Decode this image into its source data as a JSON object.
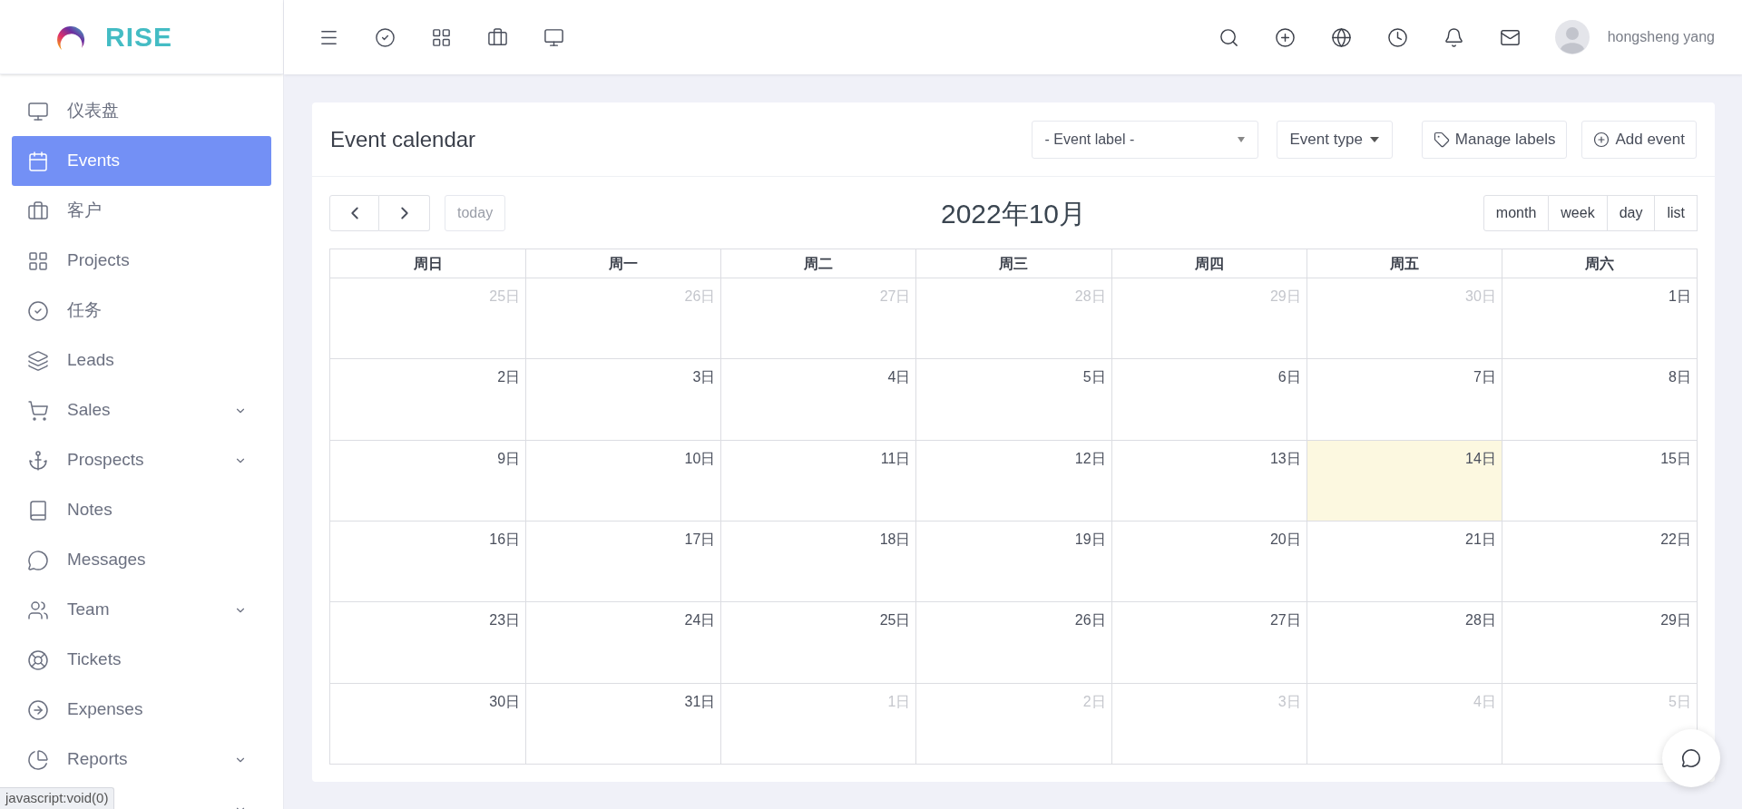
{
  "logo": {
    "text": "RISE"
  },
  "sidebar": {
    "items": [
      {
        "label": "仪表盘",
        "selected": false,
        "expandable": false
      },
      {
        "label": "Events",
        "selected": true,
        "expandable": false
      },
      {
        "label": "客户",
        "selected": false,
        "expandable": false
      },
      {
        "label": "Projects",
        "selected": false,
        "expandable": false
      },
      {
        "label": "任务",
        "selected": false,
        "expandable": false
      },
      {
        "label": "Leads",
        "selected": false,
        "expandable": false
      },
      {
        "label": "Sales",
        "selected": false,
        "expandable": true
      },
      {
        "label": "Prospects",
        "selected": false,
        "expandable": true
      },
      {
        "label": "Notes",
        "selected": false,
        "expandable": false
      },
      {
        "label": "Messages",
        "selected": false,
        "expandable": false
      },
      {
        "label": "Team",
        "selected": false,
        "expandable": true
      },
      {
        "label": "Tickets",
        "selected": false,
        "expandable": false
      },
      {
        "label": "Expenses",
        "selected": false,
        "expandable": false
      },
      {
        "label": "Reports",
        "selected": false,
        "expandable": true
      },
      {
        "selected": false,
        "expandable": true
      }
    ]
  },
  "topbar": {
    "user_name": "hongsheng yang"
  },
  "card": {
    "title": "Event calendar",
    "label_select": "- Event label -",
    "type_button": "Event type",
    "manage_button": "Manage labels",
    "add_button": "Add event"
  },
  "calendar": {
    "today_button": "today",
    "title": "2022年10月",
    "views": [
      {
        "label": "month",
        "selected": false
      },
      {
        "label": "week",
        "selected": false
      },
      {
        "label": "day",
        "selected": false
      },
      {
        "label": "list",
        "selected": false
      }
    ],
    "weekdays": [
      "周日",
      "周一",
      "周二",
      "周三",
      "周四",
      "周五",
      "周六"
    ],
    "weeks": [
      [
        {
          "day": "25日",
          "other_month": true,
          "today": false
        },
        {
          "day": "26日",
          "other_month": true,
          "today": false
        },
        {
          "day": "27日",
          "other_month": true,
          "today": false
        },
        {
          "day": "28日",
          "other_month": true,
          "today": false
        },
        {
          "day": "29日",
          "other_month": true,
          "today": false
        },
        {
          "day": "30日",
          "other_month": true,
          "today": false
        },
        {
          "day": "1日",
          "other_month": false,
          "today": false
        }
      ],
      [
        {
          "day": "2日",
          "other_month": false,
          "today": false
        },
        {
          "day": "3日",
          "other_month": false,
          "today": false
        },
        {
          "day": "4日",
          "other_month": false,
          "today": false
        },
        {
          "day": "5日",
          "other_month": false,
          "today": false
        },
        {
          "day": "6日",
          "other_month": false,
          "today": false
        },
        {
          "day": "7日",
          "other_month": false,
          "today": false
        },
        {
          "day": "8日",
          "other_month": false,
          "today": false
        }
      ],
      [
        {
          "day": "9日",
          "other_month": false,
          "today": false
        },
        {
          "day": "10日",
          "other_month": false,
          "today": false
        },
        {
          "day": "11日",
          "other_month": false,
          "today": false
        },
        {
          "day": "12日",
          "other_month": false,
          "today": false
        },
        {
          "day": "13日",
          "other_month": false,
          "today": false
        },
        {
          "day": "14日",
          "other_month": false,
          "today": true
        },
        {
          "day": "15日",
          "other_month": false,
          "today": false
        }
      ],
      [
        {
          "day": "16日",
          "other_month": false,
          "today": false
        },
        {
          "day": "17日",
          "other_month": false,
          "today": false
        },
        {
          "day": "18日",
          "other_month": false,
          "today": false
        },
        {
          "day": "19日",
          "other_month": false,
          "today": false
        },
        {
          "day": "20日",
          "other_month": false,
          "today": false
        },
        {
          "day": "21日",
          "other_month": false,
          "today": false
        },
        {
          "day": "22日",
          "other_month": false,
          "today": false
        }
      ],
      [
        {
          "day": "23日",
          "other_month": false,
          "today": false
        },
        {
          "day": "24日",
          "other_month": false,
          "today": false
        },
        {
          "day": "25日",
          "other_month": false,
          "today": false
        },
        {
          "day": "26日",
          "other_month": false,
          "today": false
        },
        {
          "day": "27日",
          "other_month": false,
          "today": false
        },
        {
          "day": "28日",
          "other_month": false,
          "today": false
        },
        {
          "day": "29日",
          "other_month": false,
          "today": false
        }
      ],
      [
        {
          "day": "30日",
          "other_month": false,
          "today": false
        },
        {
          "day": "31日",
          "other_month": false,
          "today": false
        },
        {
          "day": "1日",
          "other_month": true,
          "today": false
        },
        {
          "day": "2日",
          "other_month": true,
          "today": false
        },
        {
          "day": "3日",
          "other_month": true,
          "today": false
        },
        {
          "day": "4日",
          "other_month": true,
          "today": false
        },
        {
          "day": "5日",
          "other_month": true,
          "today": false
        }
      ]
    ]
  },
  "status_bar": {
    "text": "javascript:void(0)"
  }
}
